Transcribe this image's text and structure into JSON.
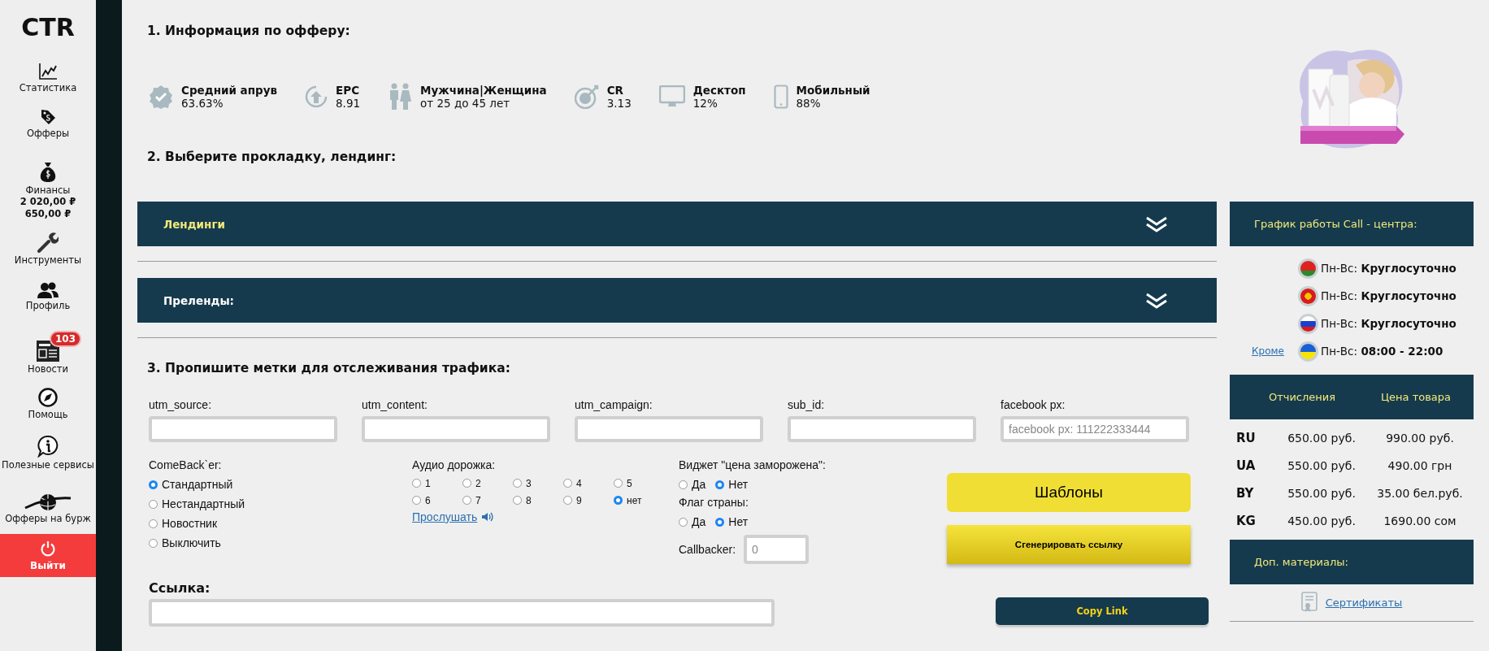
{
  "sidebar": {
    "logo": "CTR",
    "items": [
      {
        "label": "Статистика"
      },
      {
        "label": "Офферы"
      },
      {
        "label": "Финансы",
        "values": [
          "2 020,00 ₽",
          "650,00 ₽"
        ]
      },
      {
        "label": "Инструменты"
      },
      {
        "label": "Профиль"
      },
      {
        "label": "Новости",
        "badge": "103"
      },
      {
        "label": "Помощь"
      },
      {
        "label": "Полезные сервисы"
      },
      {
        "label": "Офферы на бурж"
      }
    ],
    "logout": "Выйти"
  },
  "offer_info": {
    "heading": "1. Информация по офферу:",
    "stats": [
      {
        "title": "Средний апрув",
        "value": "63.63%"
      },
      {
        "title": "EPC",
        "value": "8.91"
      },
      {
        "title": "Мужчина|Женщина",
        "value": "от 25 до 45 лет"
      },
      {
        "title": "CR",
        "value": "3.13"
      },
      {
        "title": "Десктоп",
        "value": "12%"
      },
      {
        "title": "Мобильный",
        "value": "88%"
      }
    ]
  },
  "landing": {
    "heading": "2. Выберите прокладку, лендинг:",
    "accordions": [
      {
        "title": "Лендинги",
        "selected": true
      },
      {
        "title": "Преленды:",
        "selected": false
      }
    ]
  },
  "tracking": {
    "heading": "3. Пропишите метки для отслеживания трафика:",
    "fields": [
      {
        "label": "utm_source:"
      },
      {
        "label": "utm_content:"
      },
      {
        "label": "utm_campaign:"
      },
      {
        "label": "sub_id:"
      },
      {
        "label": "facebook px:",
        "placeholder": "facebook px: 111222333444"
      }
    ],
    "comeback": {
      "label": "ComeBack`er:",
      "options": [
        {
          "label": "Стандартный",
          "selected": true
        },
        {
          "label": "Нестандартный",
          "selected": false
        },
        {
          "label": "Новостник",
          "selected": false
        },
        {
          "label": "Выключить",
          "selected": false
        }
      ]
    },
    "audio": {
      "label": "Аудио дорожка:",
      "options": [
        {
          "label": "1",
          "selected": false
        },
        {
          "label": "2",
          "selected": false
        },
        {
          "label": "3",
          "selected": false
        },
        {
          "label": "4",
          "selected": false
        },
        {
          "label": "5",
          "selected": false
        },
        {
          "label": "6",
          "selected": false
        },
        {
          "label": "7",
          "selected": false
        },
        {
          "label": "8",
          "selected": false
        },
        {
          "label": "9",
          "selected": false
        },
        {
          "label": "нет",
          "selected": true
        }
      ],
      "listen_link": "Прослушать"
    },
    "toggles": [
      {
        "label": "Виджет \"цена заморожена\":",
        "options": [
          {
            "label": "Да",
            "selected": false
          },
          {
            "label": "Нет",
            "selected": true
          }
        ]
      },
      {
        "label": "Флаг страны:",
        "options": [
          {
            "label": "Да",
            "selected": false
          },
          {
            "label": "Нет",
            "selected": true
          }
        ]
      }
    ],
    "callbacker": {
      "label": "Callbacker:",
      "placeholder": "0"
    },
    "templates_button": "Шаблоны",
    "generate_button": "Сгенерировать ссылку",
    "link": {
      "label": "Ссылка:"
    },
    "copy_button": "Copy Link"
  },
  "call_center": {
    "title": "График работы Call - центра:",
    "rows": [
      {
        "text": "Пн-Вс: **Круглосуточно**"
      },
      {
        "text": "Пн-Вс: **Круглосуточно**"
      },
      {
        "text": "Пн-Вс: **Круглосуточно**"
      },
      {
        "except_link": "Кроме",
        "text": "Пн-Вс: **08:00 - 22:00**"
      }
    ]
  },
  "prices": {
    "columns": [
      "Отчисления",
      "Цена товара"
    ],
    "rows": [
      {
        "country": "RU",
        "payout": "650.00 руб.",
        "price": "990.00 руб."
      },
      {
        "country": "UA",
        "payout": "550.00 руб.",
        "price": "490.00 грн"
      },
      {
        "country": "BY",
        "payout": "550.00 руб.",
        "price": "35.00 бел.руб."
      },
      {
        "country": "KG",
        "payout": "450.00 руб.",
        "price": "1690.00 сом"
      }
    ]
  },
  "materials": {
    "title": "Доп. материалы:",
    "link": "Сертификаты"
  }
}
